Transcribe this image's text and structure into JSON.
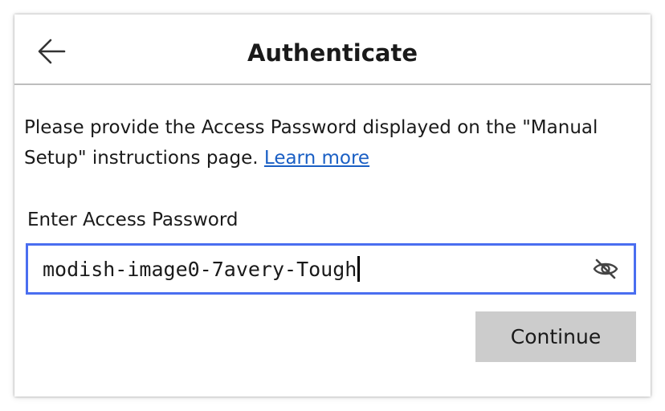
{
  "header": {
    "title": "Authenticate",
    "back_icon": "arrow-left-icon"
  },
  "description": {
    "text": "Please provide the Access Password displayed on the \"Manual Setup\" instructions page.",
    "link_label": "Learn more",
    "link_color": "#1a5fc4"
  },
  "password_field": {
    "label": "Enter Access Password",
    "value": "modish-image0-7avery-Tough",
    "visibility_icon": "eye-slash-icon",
    "focus_color": "#4a6ef0"
  },
  "actions": {
    "continue_label": "Continue",
    "continue_bg": "#cccccc"
  }
}
